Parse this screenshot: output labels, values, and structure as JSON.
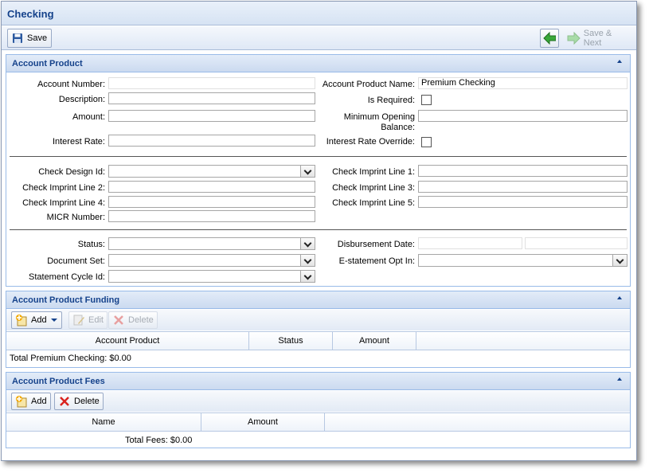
{
  "window": {
    "title": "Checking"
  },
  "toolbar": {
    "save_label": "Save",
    "save_next_label": "Save & Next"
  },
  "account_product": {
    "title": "Account Product",
    "labels": {
      "account_number": "Account Number:",
      "description": "Description:",
      "amount": "Amount:",
      "interest_rate": "Interest Rate:",
      "product_name": "Account Product Name:",
      "is_required": "Is Required:",
      "min_opening_1": "Minimum Opening",
      "min_opening_2": "Balance:",
      "interest_override": "Interest Rate Override:",
      "check_design": "Check Design Id:",
      "imprint2": "Check Imprint Line 2:",
      "imprint4": "Check Imprint Line 4:",
      "micr": "MICR Number:",
      "imprint1": "Check Imprint Line 1:",
      "imprint3": "Check Imprint Line 3:",
      "imprint5": "Check Imprint Line 5:",
      "status": "Status:",
      "document_set": "Document Set:",
      "statement_cycle": "Statement Cycle Id:",
      "disbursement_date": "Disbursement Date:",
      "estatement": "E-statement Opt In:"
    },
    "values": {
      "product_name": "Premium Checking"
    }
  },
  "funding": {
    "title": "Account Product Funding",
    "add": "Add",
    "edit": "Edit",
    "delete": "Delete",
    "columns": [
      "Account Product",
      "Status",
      "Amount"
    ],
    "total": "Total Premium Checking: $0.00"
  },
  "fees": {
    "title": "Account Product Fees",
    "add": "Add",
    "delete": "Delete",
    "columns": [
      "Name",
      "Amount"
    ],
    "total": "Total Fees: $0.00"
  }
}
